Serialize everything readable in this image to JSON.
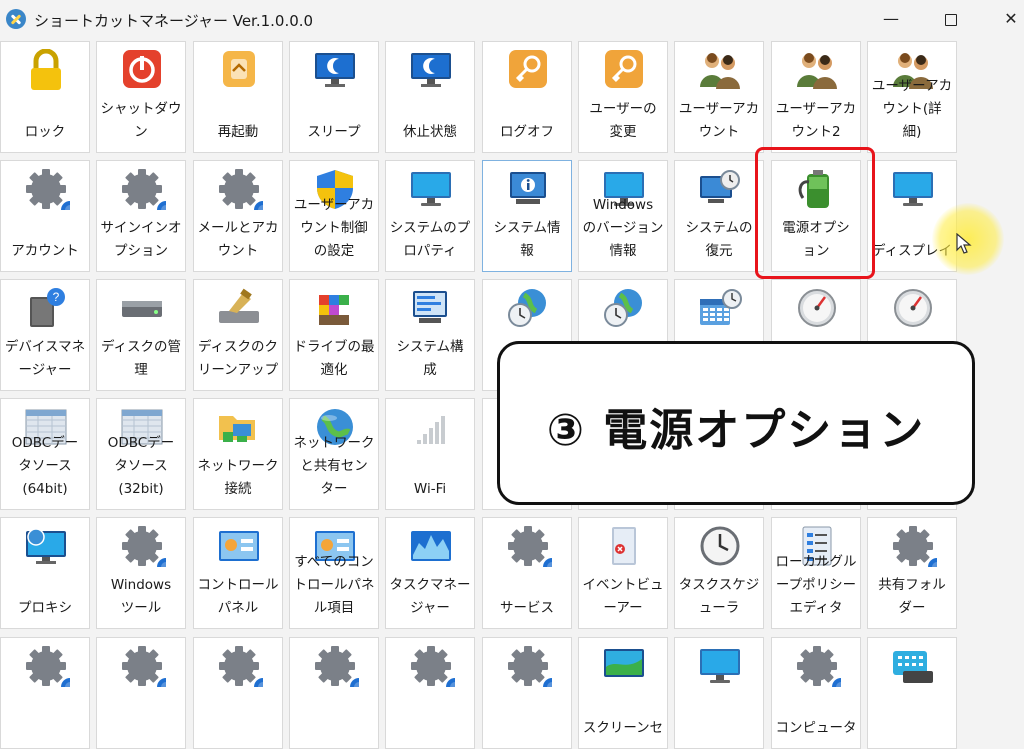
{
  "window": {
    "title": "ショートカットマネージャー Ver.1.0.0.0",
    "icon": "app-tools-icon",
    "minimize": "—",
    "close": "✕"
  },
  "tiles": [
    {
      "label": "ロック",
      "icon": "lock-icon"
    },
    {
      "label": "シャットダウ\nン",
      "icon": "power-icon"
    },
    {
      "label": "再起動",
      "icon": "restart-icon"
    },
    {
      "label": "スリープ",
      "icon": "sleep-monitor-icon"
    },
    {
      "label": "休止状態",
      "icon": "hibernate-monitor-icon"
    },
    {
      "label": "ログオフ",
      "icon": "key-icon"
    },
    {
      "label": "ユーザーの\n変更",
      "icon": "key-icon"
    },
    {
      "label": "ユーザーアカ\nウント",
      "icon": "users-icon"
    },
    {
      "label": "ユーザーアカ\nウント2",
      "icon": "users-icon"
    },
    {
      "label": "ユーザーアカ\nウント(詳\n細)",
      "icon": "users-icon"
    },
    {
      "label": "アカウント",
      "icon": "gear-icon"
    },
    {
      "label": "サインインオ\nプション",
      "icon": "gear-icon"
    },
    {
      "label": "メールとアカ\nウント",
      "icon": "gear-icon"
    },
    {
      "label": "ユーザーアカ\nウント制御\nの設定",
      "icon": "shield-icon"
    },
    {
      "label": "システムのプ\nロパティ",
      "icon": "monitor-icon"
    },
    {
      "label": "システム情\n報",
      "icon": "system-info-icon"
    },
    {
      "label": "Windows\nのバージョン\n情報",
      "icon": "monitor-icon"
    },
    {
      "label": "システムの\n復元",
      "icon": "system-restore-icon"
    },
    {
      "label": "電源オプシ\nョン",
      "icon": "battery-icon"
    },
    {
      "label": "ディスプレイ",
      "icon": "monitor-icon"
    },
    {
      "label": "デバイスマネ\nージャー",
      "icon": "device-manager-icon"
    },
    {
      "label": "ディスクの管\n理",
      "icon": "disk-icon"
    },
    {
      "label": "ディスクのク\nリーンアップ",
      "icon": "disk-cleanup-icon"
    },
    {
      "label": "ドライブの最\n適化",
      "icon": "defrag-icon"
    },
    {
      "label": "システム構\n成",
      "icon": "system-config-icon"
    },
    {
      "label": "",
      "icon": "globe-clock-icon"
    },
    {
      "label": "",
      "icon": "globe-clock-icon"
    },
    {
      "label": "",
      "icon": "calendar-clock-icon"
    },
    {
      "label": "",
      "icon": "gauge-icon"
    },
    {
      "label": "",
      "icon": "gauge-icon"
    },
    {
      "label": "ODBCデー\nタソース\n(64bit)",
      "icon": "database-icon"
    },
    {
      "label": "ODBCデー\nタソース\n(32bit)",
      "icon": "database-icon"
    },
    {
      "label": "ネットワーク\n接続",
      "icon": "network-folder-icon"
    },
    {
      "label": "ネットワーク\nと共有セン\nター",
      "icon": "globe-icon"
    },
    {
      "label": "Wi-Fi",
      "icon": "wifi-signal-icon"
    },
    {
      "label": "",
      "icon": ""
    },
    {
      "label": "",
      "icon": ""
    },
    {
      "label": "",
      "icon": ""
    },
    {
      "label": "",
      "icon": ""
    },
    {
      "label": "",
      "icon": ""
    },
    {
      "label": "プロキシ",
      "icon": "proxy-monitor-icon"
    },
    {
      "label": "Windows\nツール",
      "icon": "gear-icon"
    },
    {
      "label": "コントロール\nパネル",
      "icon": "control-panel-icon"
    },
    {
      "label": "すべてのコン\nトロールパネ\nル項目",
      "icon": "control-panel-icon"
    },
    {
      "label": "タスクマネー\nジャー",
      "icon": "task-manager-icon"
    },
    {
      "label": "サービス",
      "icon": "gear-icon"
    },
    {
      "label": "イベントビュ\nーアー",
      "icon": "event-viewer-icon"
    },
    {
      "label": "タスクスケジ\nューラ",
      "icon": "clock-icon"
    },
    {
      "label": "ローカルグル\nープポリシー\nエディタ",
      "icon": "policy-icon"
    },
    {
      "label": "共有フォル\nダー",
      "icon": "gear-icon"
    },
    {
      "label": "",
      "icon": "gear-icon"
    },
    {
      "label": "",
      "icon": "gear-icon"
    },
    {
      "label": "",
      "icon": "gear-icon"
    },
    {
      "label": "",
      "icon": "gear-icon"
    },
    {
      "label": "",
      "icon": "gear-icon"
    },
    {
      "label": "",
      "icon": "gear-icon"
    },
    {
      "label": "スクリーンセ",
      "icon": "screensaver-icon"
    },
    {
      "label": "",
      "icon": "monitor-icon"
    },
    {
      "label": "コンピュータ",
      "icon": "gear-icon"
    },
    {
      "label": "",
      "icon": "keyboard-icon"
    }
  ],
  "overlay": {
    "callout_text": "③ 電源オプション",
    "highlight_color": "#e8141b",
    "cursor_glow_color": "#ffec3c"
  }
}
